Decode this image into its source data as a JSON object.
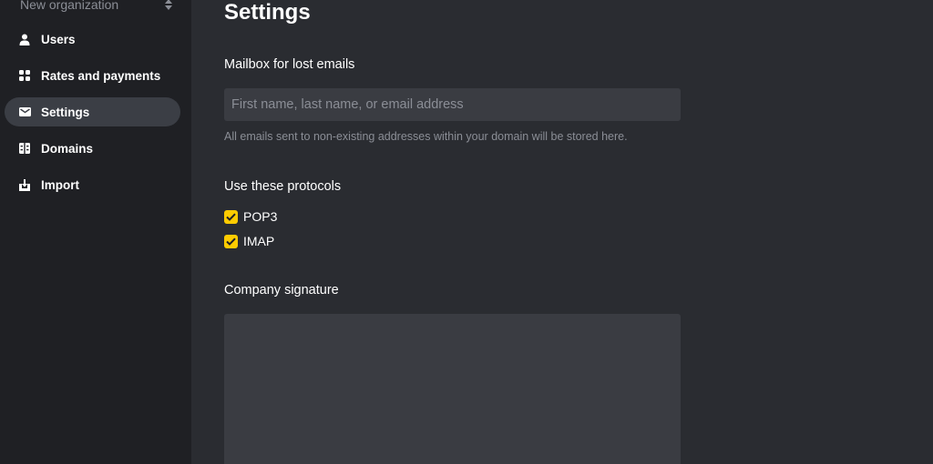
{
  "sidebar": {
    "org_name": "New organization",
    "items": [
      {
        "label": "Users",
        "icon": "user-icon"
      },
      {
        "label": "Rates and payments",
        "icon": "grid-icon"
      },
      {
        "label": "Settings",
        "icon": "envelope-icon",
        "active": true
      },
      {
        "label": "Domains",
        "icon": "domains-icon"
      },
      {
        "label": "Import",
        "icon": "import-icon"
      }
    ]
  },
  "main": {
    "title": "Settings",
    "mailbox": {
      "label": "Mailbox for lost emails",
      "placeholder": "First name, last name, or email address",
      "value": "",
      "hint": "All emails sent to non-existing addresses within your domain will be stored here."
    },
    "protocols": {
      "label": "Use these protocols",
      "options": [
        {
          "label": "POP3",
          "checked": true
        },
        {
          "label": "IMAP",
          "checked": true
        }
      ]
    },
    "signature": {
      "label": "Company signature",
      "value": ""
    }
  },
  "colors": {
    "sidebar_bg": "#1f2024",
    "main_bg": "#2a2c31",
    "input_bg": "#3a3c42",
    "accent": "#ffcc00",
    "muted_text": "#8b8e96"
  }
}
